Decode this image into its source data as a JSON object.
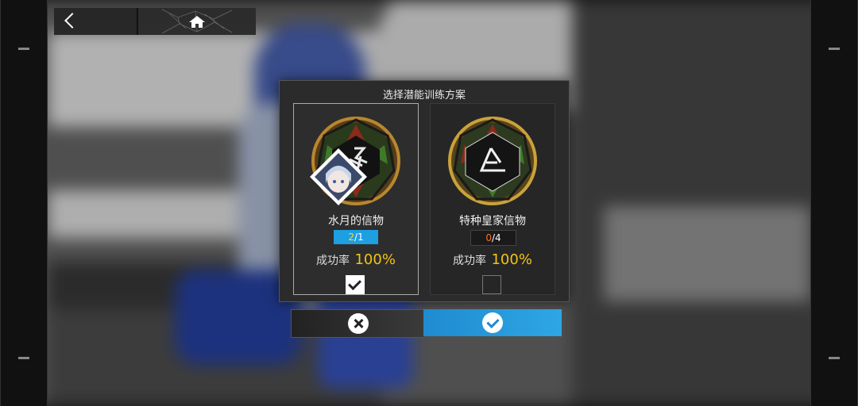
{
  "dialog": {
    "title": "选择潜能训练方案",
    "options": [
      {
        "name": "水月的信物",
        "current": "2",
        "total": "1",
        "rate_label": "成功率",
        "rate_value": "100%",
        "selected": true
      },
      {
        "name": "特种皇家信物",
        "current": "0",
        "total": "4",
        "rate_label": "成功率",
        "rate_value": "100%",
        "selected": false
      }
    ]
  },
  "colors": {
    "accent": "#1d9fe2",
    "rate": "#f2c414",
    "count_warn": "#ff6b2a"
  },
  "icons": {
    "back": "chevron-left-icon",
    "home": "home-icon",
    "cancel": "close-circle-icon",
    "confirm": "check-circle-icon"
  }
}
